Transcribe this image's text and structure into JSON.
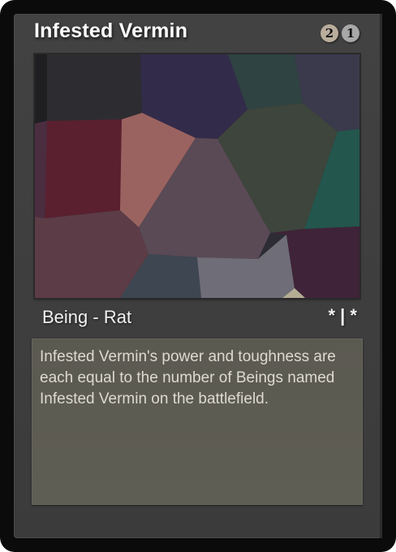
{
  "card": {
    "name": "Infested Vermin",
    "mana_cost": [
      {
        "symbol": "2",
        "kind": "generic",
        "color": "#b9ae9c"
      },
      {
        "symbol": "1",
        "kind": "colored",
        "color": "#a8a8a8"
      }
    ],
    "type_line": "Being - Rat",
    "power_toughness": "* | *",
    "rules_text": "Infested Vermin's power and toughness are each equal to the number of Beings named Infested Vermin on the battlefield."
  },
  "colors": {
    "frame": "#0b0b0b",
    "body": "#3f3f3f",
    "text_box": "#5d5c52",
    "text": "#dedad0"
  }
}
